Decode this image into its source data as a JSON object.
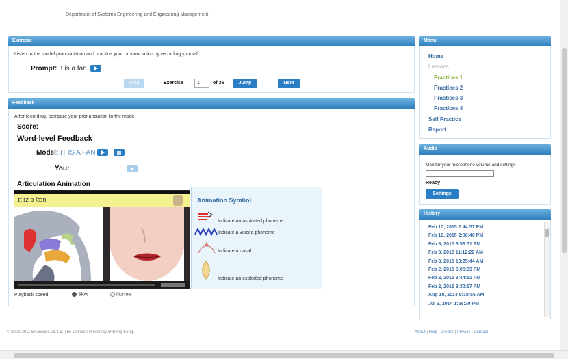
{
  "header": {
    "department": "Department of Systems Engineering and Engineering Management"
  },
  "exercise": {
    "title": "Exercise",
    "instructions": "Listen to the model pronunciation and practice your pronunciation by recording yourself",
    "prompt_label": "Prompt:",
    "prompt_text": "It is a fan.",
    "stop_label": "Stop",
    "exercise_label": "Exercise",
    "exercise_value": "1",
    "of_label": "of 36",
    "jump_label": "Jump",
    "next_label": "Next"
  },
  "feedback": {
    "title": "Feedback",
    "instructions": "After recording, compare your pronunciation to the model",
    "score_label": "Score:",
    "word_level_title": "Word-level Feedback",
    "model_label": "Model:",
    "model_text": "IT IS A FAN",
    "you_label": "You:",
    "articulation_title": "Articulation Animation",
    "phonetic_text": "ɪt ɪz ə fæn",
    "playback_label": "Playback speed:",
    "speed_options": [
      "Slow",
      "Normal"
    ],
    "selected_speed": "Slow"
  },
  "animation_symbol": {
    "title": "Animation Symbol",
    "items": [
      {
        "icon": "aspirated-icon",
        "text": "Indicate an aspirated phoneme"
      },
      {
        "icon": "voiced-icon",
        "text": "Indicate a voiced phoneme"
      },
      {
        "icon": "nasal-icon",
        "text": "Indicate a nasal"
      },
      {
        "icon": "exploded-icon",
        "text": "Indicate an exploded phoneme"
      }
    ]
  },
  "menu": {
    "title": "Menu",
    "items": [
      {
        "label": "Home",
        "style": "link"
      },
      {
        "label": "Lessons",
        "style": "muted"
      },
      {
        "label": "Practices 1",
        "style": "active"
      },
      {
        "label": "Practices 2",
        "style": "link"
      },
      {
        "label": "Practices 3",
        "style": "link"
      },
      {
        "label": "Practices 4",
        "style": "link"
      },
      {
        "label": "Self Practice",
        "style": "link"
      },
      {
        "label": "Report",
        "style": "link"
      }
    ]
  },
  "audio": {
    "title": "Audio",
    "description": "Monitor your microphone volume and settings",
    "status": "Ready",
    "settings_label": "Settings"
  },
  "history": {
    "title": "History",
    "items": [
      "Feb 10, 2015 2:44:57 PM",
      "Feb 10, 2015 2:06:40 PM",
      "Feb 9, 2015 3:53:51 PM",
      "Feb 3, 2015 11:12:22 AM",
      "Feb 3, 2015 10:25:44 AM",
      "Feb 2, 2015 5:05:33 PM",
      "Feb 2, 2015 3:44:51 PM",
      "Feb 2, 2015 3:30:57 PM",
      "Aug 18, 2014 9:18:55 AM",
      "Jul 3, 2014 1:55:39 PM"
    ]
  },
  "footer": {
    "copyright": "© 2009-2011 Enunciate v1.4.3, The Chinese University of Hong Kong.",
    "links": [
      "About",
      "Help",
      "Credits",
      "Privacy",
      "Contact"
    ]
  },
  "colors": {
    "accent": "#2a7fc4",
    "header_gradient_top": "#6fb4e0",
    "link": "#3a6ea5",
    "active": "#8ab23a"
  }
}
